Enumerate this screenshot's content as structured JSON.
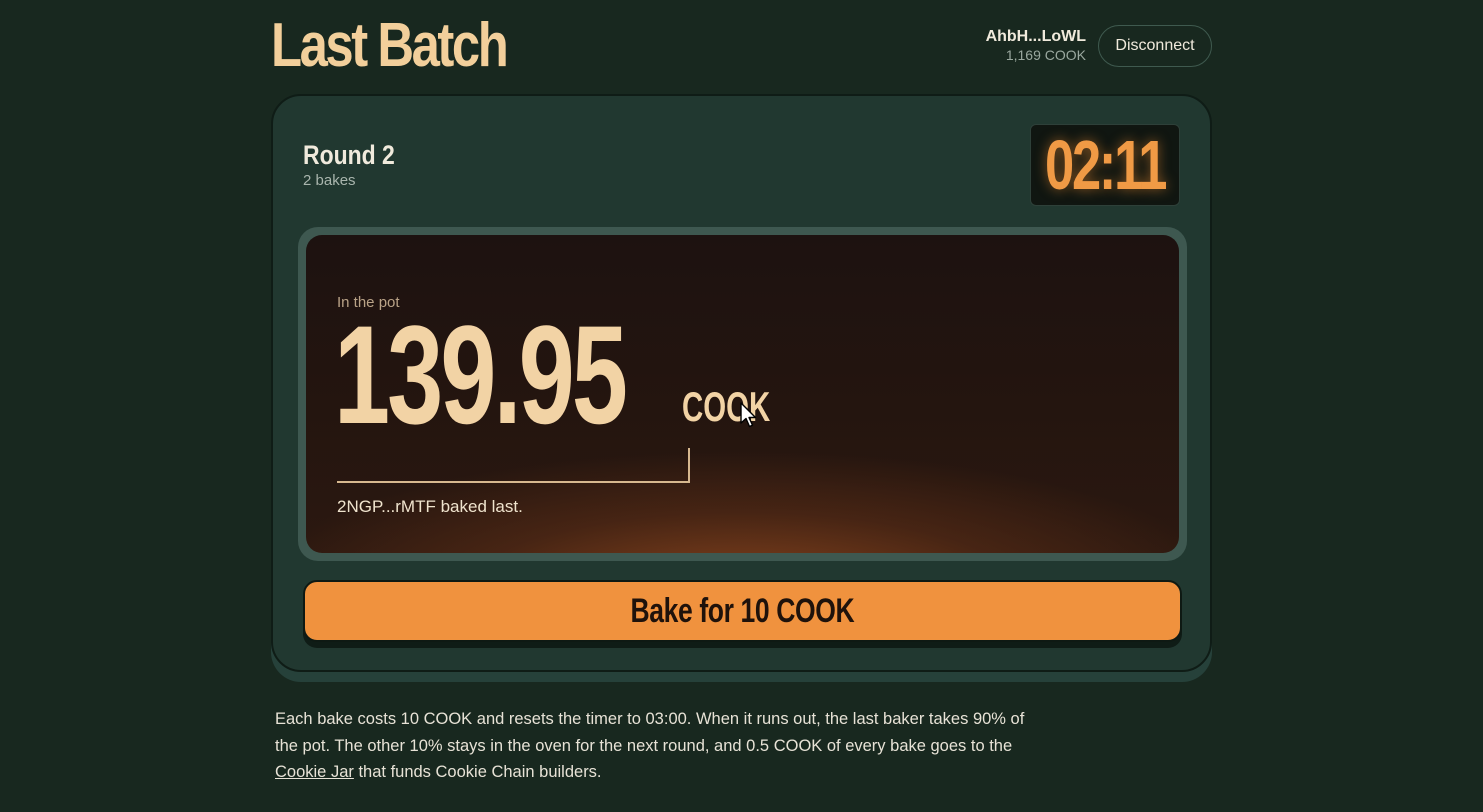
{
  "header": {
    "title": "Last Batch",
    "wallet_address": "AhbH...LoWL",
    "wallet_balance": "1,169 COOK",
    "disconnect_label": "Disconnect"
  },
  "round": {
    "title": "Round 2",
    "bakes": "2 bakes",
    "timer": "02:11"
  },
  "pot": {
    "label": "In the pot",
    "value": "139.95",
    "unit": "COOK",
    "last_baker_text": "2NGP...rMTF baked last."
  },
  "bake_button": {
    "label": "Bake for 10 COOK"
  },
  "info": {
    "text_before_link": "Each bake costs 10 COOK and resets the timer to 03:00. When it runs out, the last baker takes 90% of the pot. The other 10% stays in the oven for the next round, and 0.5 COOK of every bake goes to the ",
    "link_label": "Cookie Jar",
    "text_after_link": " that funds Cookie Chain builders."
  },
  "colors": {
    "background": "#18281f",
    "panel": "#213830",
    "accent_orange": "#f0923e",
    "title_cream": "#f2cf9b",
    "timer_orange": "#f09a45"
  }
}
